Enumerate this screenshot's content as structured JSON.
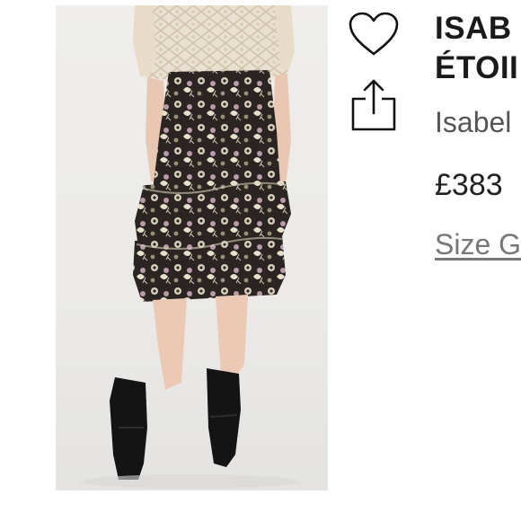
{
  "product": {
    "title_line1": "ISAB",
    "title_line2": "ÉTOII",
    "designer": "Isabel",
    "price": "£383",
    "size_guide_link": "Size G"
  },
  "icons": {
    "favorite": "heart-outline-icon",
    "share": "share-icon"
  },
  "colors": {
    "text_primary": "#1a1a1a",
    "text_secondary": "#555555",
    "link": "#777777",
    "photo_bg": "#ecebe9"
  }
}
